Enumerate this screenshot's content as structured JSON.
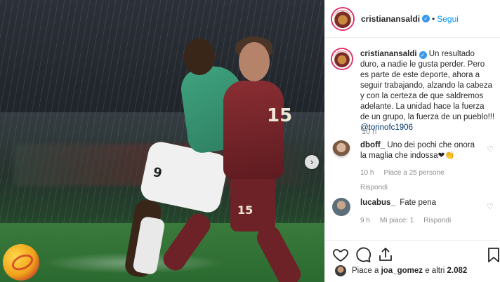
{
  "post": {
    "author": "cristianansaldi",
    "follow_label": "Segui",
    "separator": "•",
    "verified_glyph": "✓",
    "carousel_glyph": "›",
    "kit_numbers": {
      "torino_back": "15",
      "torino_shorts": "15",
      "inter_shorts": "9"
    }
  },
  "caption": {
    "username": "cristianansaldi",
    "text": "Un resultado duro, a nadie le gusta perder. Pero es parte de este deporte, ahora a seguir trabajando, alzando la cabeza y con la certeza de que saldremos adelante. La unidad hace la fuerza de un grupo, la fuerza de un pueblo!!!",
    "mention": "@torinofc1906",
    "time": "10 h"
  },
  "comments": [
    {
      "username": "dboff_",
      "text": "Uno dei pochi che onora la maglia che indossa",
      "emoji": "❤👏",
      "time": "10 h",
      "likes": "Piace a 25 persone",
      "reply": "Rispondi"
    },
    {
      "username": "lucabus_",
      "text": "Fate pena",
      "time": "9 h",
      "likes": "Mi piace: 1",
      "reply": "Rispondi"
    }
  ],
  "footer": {
    "likes_prefix": "Piace a",
    "likes_user": "joa_gomez",
    "likes_suffix": "e altri",
    "likes_count": "2.082"
  },
  "icons": {
    "like": "heart-icon",
    "comment": "comment-icon",
    "share": "share-icon",
    "save": "bookmark-icon",
    "comment_like": "heart-outline-icon",
    "carousel": "chevron-right-icon"
  },
  "colors": {
    "link_blue": "#0095f6",
    "verified_blue": "#3897f0",
    "mention": "#00376b",
    "meta_gray": "#8e8e8e"
  }
}
